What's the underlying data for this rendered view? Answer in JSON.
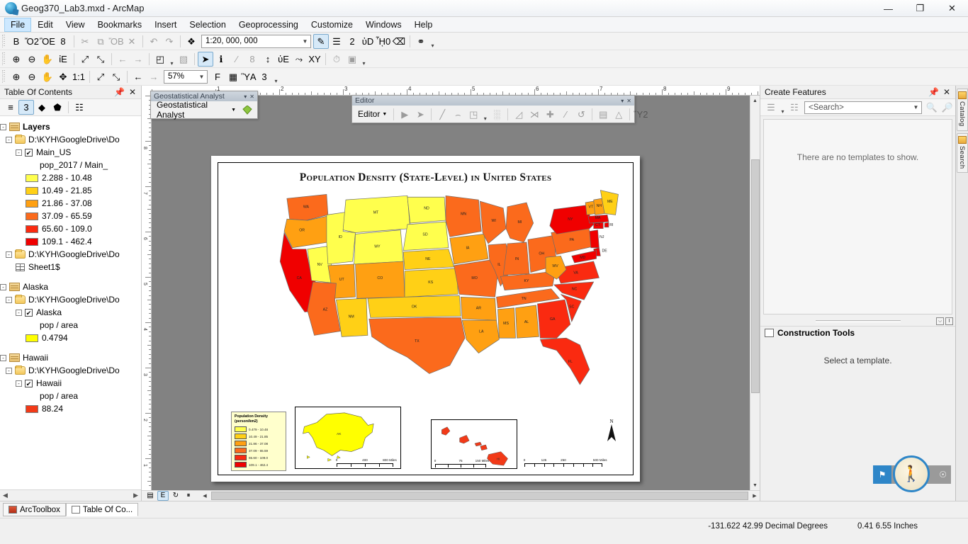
{
  "window": {
    "title": "Geog370_Lab3.mxd - ArcMap",
    "minimize": "—",
    "maximize": "❐",
    "close": "✕"
  },
  "menu": {
    "items": [
      {
        "label": "File",
        "active": true
      },
      {
        "label": "Edit",
        "active": false
      },
      {
        "label": "View",
        "active": false
      },
      {
        "label": "Bookmarks",
        "active": false
      },
      {
        "label": "Insert",
        "active": false
      },
      {
        "label": "Selection",
        "active": false
      },
      {
        "label": "Geoprocessing",
        "active": false
      },
      {
        "label": "Customize",
        "active": false
      },
      {
        "label": "Windows",
        "active": false
      },
      {
        "label": "Help",
        "active": false
      }
    ]
  },
  "standard_toolbar": {
    "buttons": [
      {
        "name": "new-document-icon",
        "glyph": "὜B"
      },
      {
        "name": "open-icon",
        "glyph": "Ὄ2"
      },
      {
        "name": "save-icon",
        "glyph": "ὋE"
      },
      {
        "name": "print-icon",
        "glyph": "὚8"
      },
      {
        "name": "cut-icon",
        "glyph": "✂"
      },
      {
        "name": "copy-icon",
        "glyph": "⧉"
      },
      {
        "name": "paste-icon",
        "glyph": "ὌB"
      },
      {
        "name": "delete-icon",
        "glyph": "✕"
      },
      {
        "name": "undo-icon",
        "glyph": "↶"
      },
      {
        "name": "redo-icon",
        "glyph": "↷"
      },
      {
        "name": "add-data-icon",
        "glyph": "❖"
      }
    ],
    "scale_value": "1:20, 000, 000",
    "right_buttons": [
      {
        "name": "edit-vertices-icon",
        "glyph": "✎"
      },
      {
        "name": "table-of-contents-icon",
        "glyph": "☰"
      },
      {
        "name": "catalog-window-icon",
        "glyph": "὜2"
      },
      {
        "name": "search-window-icon",
        "glyph": "ὐD"
      },
      {
        "name": "arctoolbox-icon",
        "glyph": "ᾟ0"
      },
      {
        "name": "python-window-icon",
        "glyph": "⌫"
      },
      {
        "name": "model-builder-icon",
        "glyph": "⚭"
      }
    ]
  },
  "tools_toolbar": {
    "buttons": [
      {
        "name": "zoom-in-icon",
        "glyph": "⊕"
      },
      {
        "name": "zoom-out-icon",
        "glyph": "⊖"
      },
      {
        "name": "pan-icon",
        "glyph": "✋"
      },
      {
        "name": "full-extent-icon",
        "glyph": "ἰE"
      },
      {
        "name": "fixed-zoom-in-icon",
        "glyph": "⤢"
      },
      {
        "name": "fixed-zoom-out-icon",
        "glyph": "⤡"
      },
      {
        "name": "go-back-extent-icon",
        "glyph": "←"
      },
      {
        "name": "go-next-extent-icon",
        "glyph": "→"
      },
      {
        "name": "select-features-icon",
        "glyph": "◰"
      },
      {
        "name": "clear-selection-icon",
        "glyph": "▧"
      },
      {
        "name": "select-elements-icon",
        "glyph": "➤"
      },
      {
        "name": "identify-icon",
        "glyph": "ℹ"
      },
      {
        "name": "hyperlink-icon",
        "glyph": "∕"
      },
      {
        "name": "html-popup-icon",
        "glyph": "὞8"
      },
      {
        "name": "measure-icon",
        "glyph": "↕"
      },
      {
        "name": "find-icon",
        "glyph": "ὐE"
      },
      {
        "name": "find-route-icon",
        "glyph": "⤳"
      },
      {
        "name": "go-to-xy-icon",
        "glyph": "XY"
      },
      {
        "name": "time-slider-icon",
        "glyph": "⏱"
      },
      {
        "name": "create-viewer-window-icon",
        "glyph": "▣"
      }
    ]
  },
  "layout_toolbar": {
    "buttons": [
      {
        "name": "layout-zoom-in-icon",
        "glyph": "⊕"
      },
      {
        "name": "layout-zoom-out-icon",
        "glyph": "⊖"
      },
      {
        "name": "layout-pan-icon",
        "glyph": "✋"
      },
      {
        "name": "zoom-whole-page-icon",
        "glyph": "✥"
      },
      {
        "name": "zoom-100-percent-icon",
        "glyph": "1:1"
      },
      {
        "name": "layout-fixed-zoom-in-icon",
        "glyph": "⤢"
      },
      {
        "name": "layout-fixed-zoom-out-icon",
        "glyph": "⤡"
      },
      {
        "name": "go-back-layout-extent-icon",
        "glyph": "←"
      },
      {
        "name": "go-forward-layout-extent-icon",
        "glyph": "→"
      }
    ],
    "zoom_value": "57%",
    "right_buttons": [
      {
        "name": "toggle-draft-mode-icon",
        "glyph": "὜F"
      },
      {
        "name": "focus-data-frame-icon",
        "glyph": "▦"
      },
      {
        "name": "change-layout-icon",
        "glyph": "ὛA"
      },
      {
        "name": "data-driven-pages-icon",
        "glyph": "὜3"
      }
    ]
  },
  "geostatistical_analyst_toolbar": {
    "title": "Geostatistical Analyst",
    "menu_label": "Geostatistical Analyst",
    "caret": "▾",
    "close": "✕",
    "collapse": "▾"
  },
  "editor_toolbar": {
    "title": "Editor",
    "menu_label": "Editor",
    "caret": "▾",
    "close": "✕",
    "collapse": "▾",
    "buttons": [
      {
        "name": "edit-tool-icon",
        "glyph": "▶"
      },
      {
        "name": "edit-annotation-tool-icon",
        "glyph": "➤"
      },
      {
        "name": "straight-segment-icon",
        "glyph": "╱"
      },
      {
        "name": "end-point-arc-segment-icon",
        "glyph": "⌢"
      },
      {
        "name": "trace-icon",
        "glyph": "◳"
      },
      {
        "name": "construction-grid-icon",
        "glyph": "░"
      },
      {
        "name": "edit-vertices-tool-icon",
        "glyph": "◿"
      },
      {
        "name": "reshape-feature-icon",
        "glyph": "⋊"
      },
      {
        "name": "cut-polygons-icon",
        "glyph": "✚"
      },
      {
        "name": "split-tool-icon",
        "glyph": "∕"
      },
      {
        "name": "rotate-icon",
        "glyph": "↺"
      },
      {
        "name": "attributes-icon",
        "glyph": "▤"
      },
      {
        "name": "sketch-properties-icon",
        "glyph": "△"
      },
      {
        "name": "create-features-window-icon",
        "glyph": "Ὕ2"
      }
    ]
  },
  "table_of_contents": {
    "title": "Table Of Contents",
    "pin": "ὌC",
    "close": "✕",
    "tool_buttons": [
      {
        "name": "list-by-drawing-order-icon",
        "glyph": "≡",
        "selected": false
      },
      {
        "name": "list-by-source-icon",
        "glyph": "὜3",
        "selected": true
      },
      {
        "name": "list-by-visibility-icon",
        "glyph": "◆",
        "selected": false
      },
      {
        "name": "list-by-selection-icon",
        "glyph": "⬟",
        "selected": false
      },
      {
        "name": "options-icon",
        "glyph": "☷",
        "selected": false
      }
    ],
    "tree": [
      {
        "indent": 0,
        "expander": "-",
        "icon": "stack",
        "label": "Layers",
        "bold": true
      },
      {
        "indent": 1,
        "expander": "-",
        "icon": "folder",
        "label": "D:\\KYH\\GoogleDrive\\Do"
      },
      {
        "indent": 2,
        "expander": "-",
        "checkbox": true,
        "label": "Main_US"
      },
      {
        "indent": 4,
        "label": "pop_2017 / Main_"
      },
      {
        "indent": 3,
        "swatch": "#FFFF4D",
        "label": "2.288 - 10.48"
      },
      {
        "indent": 3,
        "swatch": "#FFD016",
        "label": "10.49 - 21.85"
      },
      {
        "indent": 3,
        "swatch": "#FFA012",
        "label": "21.86 - 37.08"
      },
      {
        "indent": 3,
        "swatch": "#FB6A1C",
        "label": "37.09 - 65.59"
      },
      {
        "indent": 3,
        "swatch": "#FA2A10",
        "label": "65.60 - 109.0"
      },
      {
        "indent": 3,
        "swatch": "#F00000",
        "label": "109.1 - 462.4"
      },
      {
        "indent": 1,
        "expander": "-",
        "icon": "folder",
        "label": "D:\\KYH\\GoogleDrive\\Do"
      },
      {
        "indent": 2,
        "icon": "table",
        "label": "Sheet1$"
      },
      {
        "indent": -1,
        "label": ""
      },
      {
        "indent": 0,
        "expander": "-",
        "icon": "stack",
        "label": "Alaska"
      },
      {
        "indent": 1,
        "expander": "-",
        "icon": "folder",
        "label": "D:\\KYH\\GoogleDrive\\Do"
      },
      {
        "indent": 2,
        "expander": "-",
        "checkbox": true,
        "label": "Alaska"
      },
      {
        "indent": 4,
        "label": "pop / area"
      },
      {
        "indent": 3,
        "swatch": "#FFFF00",
        "label": "0.4794"
      },
      {
        "indent": -1,
        "label": ""
      },
      {
        "indent": 0,
        "expander": "-",
        "icon": "stack",
        "label": "Hawaii"
      },
      {
        "indent": 1,
        "expander": "-",
        "icon": "folder",
        "label": "D:\\KYH\\GoogleDrive\\Do"
      },
      {
        "indent": 2,
        "expander": "-",
        "checkbox": true,
        "label": "Hawaii"
      },
      {
        "indent": 4,
        "label": "pop / area"
      },
      {
        "indent": 3,
        "swatch": "#F23A18",
        "label": "88.24"
      }
    ]
  },
  "map": {
    "title": "Population Density (State-Level) in United States",
    "legend": {
      "title_line1": "Population Density",
      "title_line2": "(person/km2)",
      "classes": [
        {
          "color": "#FFFF4D",
          "label": "0.479 - 10.48"
        },
        {
          "color": "#FFD016",
          "label": "10.49 - 21.85"
        },
        {
          "color": "#FFA012",
          "label": "21.86 - 37.08"
        },
        {
          "color": "#FB6A1C",
          "label": "37.09 - 65.59"
        },
        {
          "color": "#FA2A10",
          "label": "65.60 - 109.0"
        },
        {
          "color": "#F00000",
          "label": "109.1 - 462.4"
        }
      ]
    },
    "north_arrow_label": "N",
    "scalebars": [
      {
        "name": "alaska-scalebar",
        "ticks": [
          "0",
          "400",
          "800 Miles"
        ]
      },
      {
        "name": "hawaii-scalebar",
        "ticks": [
          "0",
          "75",
          "150 Miles"
        ]
      },
      {
        "name": "main-scalebar",
        "ticks": [
          "0",
          "125",
          "250",
          "500 Miles"
        ]
      }
    ],
    "inset_labels": {
      "alaska": "AK",
      "hawaii": "HI"
    },
    "state_labels": [
      "WA",
      "OR",
      "ID",
      "MT",
      "ND",
      "MN",
      "WI",
      "MI",
      "NY",
      "VT",
      "NH",
      "ME",
      "MA",
      "RI",
      "CT",
      "NV",
      "UT",
      "WY",
      "SD",
      "IA",
      "IL",
      "IN",
      "OH",
      "PA",
      "NJ",
      "DE",
      "MD",
      "CA",
      "AZ",
      "CO",
      "NE",
      "MO",
      "KY",
      "WV",
      "VA",
      "NC",
      "NM",
      "KS",
      "AR",
      "TN",
      "SC",
      "GA",
      "OK",
      "LA",
      "MS",
      "AL",
      "FL",
      "TX"
    ]
  },
  "create_features": {
    "title": "Create Features",
    "pin": "ὌC",
    "close": "✕",
    "search_placeholder": "<Search>",
    "empty_message": "There are no templates to show.",
    "tool_buttons": [
      {
        "name": "organize-templates-icon",
        "glyph": "☷"
      },
      {
        "name": "create-new-template-icon",
        "glyph": "⊞"
      }
    ],
    "search_buttons": [
      {
        "name": "search-icon",
        "glyph": "ὐD"
      },
      {
        "name": "clear-search-icon",
        "glyph": "✕"
      }
    ]
  },
  "construction_tools": {
    "title": "Construction Tools",
    "icon": "construction-tools-icon",
    "message": "Select a template.",
    "tools": [
      {
        "name": "point-tool-icon",
        "glyph": "⚑"
      },
      {
        "name": "polygon-tool-icon",
        "glyph": "⬟"
      }
    ]
  },
  "side_tabs": [
    {
      "name": "catalog-tab",
      "label": "Catalog",
      "icon": "catalog-icon"
    },
    {
      "name": "search-tab",
      "label": "Search",
      "icon": "search-tab-icon"
    }
  ],
  "bottom_tabs": [
    {
      "name": "arctoolbox-tab",
      "label": "ArcToolbox",
      "icon": "arctoolbox-icon",
      "active": false
    },
    {
      "name": "table-of-contents-tab",
      "label": "Table Of Co...",
      "icon": "toc-icon",
      "active": true
    }
  ],
  "view_buttons": [
    {
      "name": "data-view-icon",
      "glyph": "▤",
      "selected": false
    },
    {
      "name": "layout-view-icon",
      "glyph": "὜E",
      "selected": true
    },
    {
      "name": "refresh-view-icon",
      "glyph": "↻",
      "selected": false
    },
    {
      "name": "pause-drawing-icon",
      "glyph": "⏸",
      "selected": false
    },
    {
      "name": "collapse-icon",
      "glyph": "‹",
      "selected": false
    }
  ],
  "statusbar": {
    "coordinates": "-131.622  42.99 Decimal Degrees",
    "page_coordinates": "0.41  6.55 Inches"
  },
  "rulers": {
    "horizontal_ticks": [
      "1",
      "2",
      "3"
    ],
    "vertical_ticks": [
      "8",
      "7",
      "6",
      "5",
      "4",
      "3",
      "2",
      "1"
    ]
  },
  "colors": {
    "accent": "#cde8ff",
    "ramp": [
      "#FFFF4D",
      "#FFD016",
      "#FFA012",
      "#FB6A1C",
      "#FA2A10",
      "#F00000"
    ]
  }
}
